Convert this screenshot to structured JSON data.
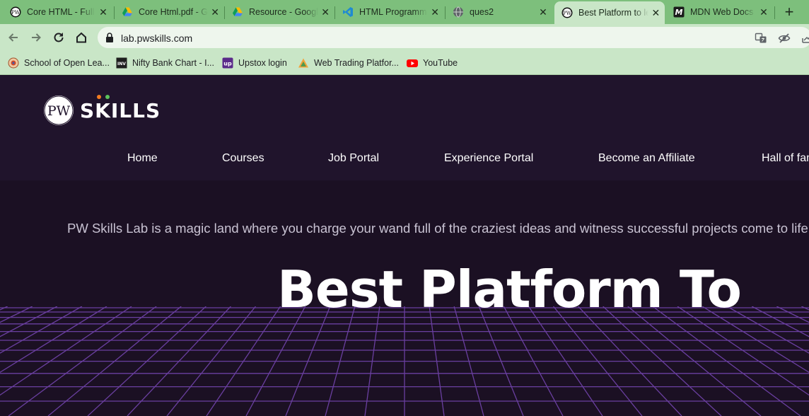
{
  "browser": {
    "tabs": [
      {
        "title": "Core HTML - Full",
        "icon": "pwskills-favicon-icon"
      },
      {
        "title": "Core Html.pdf - Google Drive",
        "icon": "google-drive-icon"
      },
      {
        "title": "Resource - Google Drive",
        "icon": "google-drive-icon"
      },
      {
        "title": "HTML Programming",
        "icon": "vscode-icon"
      },
      {
        "title": "ques2",
        "icon": "globe-icon"
      },
      {
        "title": "Best Platform to learn",
        "icon": "pwskills-favicon-icon",
        "active": true
      },
      {
        "title": "MDN Web Docs",
        "icon": "mdn-icon"
      }
    ],
    "new_tab_label": "+",
    "close_glyph": "✕",
    "url": "lab.pwskills.com",
    "bookmarks": [
      {
        "label": "School of Open Lea...",
        "icon": "school-seal-icon"
      },
      {
        "label": "Nifty Bank Chart - I...",
        "icon": "investing-icon"
      },
      {
        "label": "Upstox login",
        "icon": "upstox-icon"
      },
      {
        "label": "Web Trading Platfor...",
        "icon": "trading-platform-icon"
      },
      {
        "label": "YouTube",
        "icon": "youtube-icon"
      }
    ],
    "favicon_text": {
      "investing": "INV",
      "upstox": "up",
      "mdn": "M"
    }
  },
  "site": {
    "logo_mark_text": "PW",
    "logo_word": "SKILLS",
    "nav": [
      {
        "label": "Home"
      },
      {
        "label": "Courses"
      },
      {
        "label": "Job Portal"
      },
      {
        "label": "Experience Portal"
      },
      {
        "label": "Become an Affiliate"
      },
      {
        "label": "Hall of fame"
      }
    ],
    "tagline": "PW Skills Lab is a magic land where you charge your wand full of the craziest ideas and witness successful projects come to life",
    "hero_title": "Best Platform To"
  },
  "colors": {
    "tab_strip": "#7dbf7c",
    "toolbar": "#c9e6c7",
    "site_background": "#1b1023",
    "header_background": "#20142c",
    "grid_line": "#6a3fa0",
    "logo_dot_orange": "#f47c20",
    "logo_dot_green": "#5cc35c"
  }
}
